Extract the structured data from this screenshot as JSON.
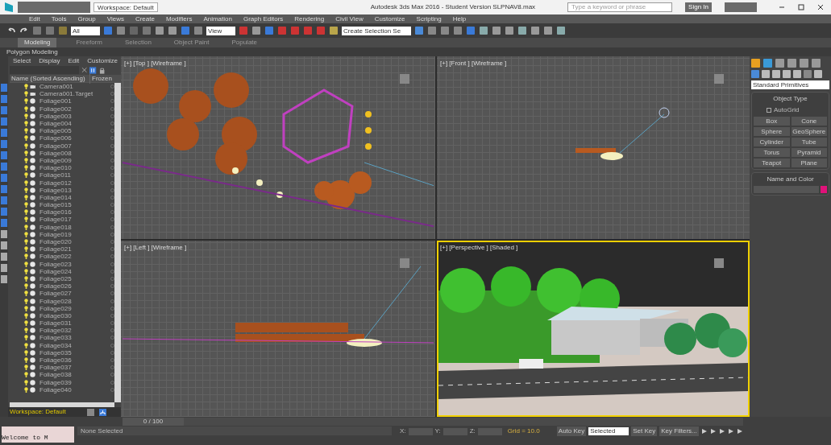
{
  "window": {
    "title": "Autodesk 3ds Max 2016 - Student Version   SLPNAV8.max",
    "workspace": "Workspace: Default",
    "search_placeholder": "Type a keyword or phrase",
    "sign_in": "Sign In"
  },
  "menu": [
    "Edit",
    "Tools",
    "Group",
    "Views",
    "Create",
    "Modifiers",
    "Animation",
    "Graph Editors",
    "Rendering",
    "Civil View",
    "Customize",
    "Scripting",
    "Help"
  ],
  "toolbar": {
    "filter": "All",
    "coord": "View",
    "selection_set": "Create Selection Se"
  },
  "ribbon_tabs": [
    {
      "label": "Modeling",
      "selected": true
    },
    {
      "label": "Freeform",
      "selected": false
    },
    {
      "label": "Selection",
      "selected": false
    },
    {
      "label": "Object Paint",
      "selected": false
    },
    {
      "label": "Populate",
      "selected": false
    }
  ],
  "ribbon_panel": "Polygon Modeling",
  "scene_explorer": {
    "menu": [
      "Select",
      "Display",
      "Edit",
      "Customize"
    ],
    "columns": [
      "Name (Sorted Ascending)",
      "Frozen"
    ],
    "rows": [
      {
        "name": "Camera001",
        "kind": "camera"
      },
      {
        "name": "Camera001.Target",
        "kind": "camera"
      },
      {
        "name": "Foliage001",
        "kind": "foliage"
      },
      {
        "name": "Foliage002",
        "kind": "foliage"
      },
      {
        "name": "Foliage003",
        "kind": "foliage"
      },
      {
        "name": "Foliage004",
        "kind": "foliage"
      },
      {
        "name": "Foliage005",
        "kind": "foliage"
      },
      {
        "name": "Foliage006",
        "kind": "foliage"
      },
      {
        "name": "Foliage007",
        "kind": "foliage"
      },
      {
        "name": "Foliage008",
        "kind": "foliage"
      },
      {
        "name": "Foliage009",
        "kind": "foliage"
      },
      {
        "name": "Foliage010",
        "kind": "foliage"
      },
      {
        "name": "Foliage011",
        "kind": "foliage"
      },
      {
        "name": "Foliage012",
        "kind": "foliage"
      },
      {
        "name": "Foliage013",
        "kind": "foliage"
      },
      {
        "name": "Foliage014",
        "kind": "foliage"
      },
      {
        "name": "Foliage015",
        "kind": "foliage"
      },
      {
        "name": "Foliage016",
        "kind": "foliage"
      },
      {
        "name": "Foliage017",
        "kind": "foliage"
      },
      {
        "name": "Foliage018",
        "kind": "foliage"
      },
      {
        "name": "Foliage019",
        "kind": "foliage"
      },
      {
        "name": "Foliage020",
        "kind": "foliage"
      },
      {
        "name": "Foliage021",
        "kind": "foliage"
      },
      {
        "name": "Foliage022",
        "kind": "foliage"
      },
      {
        "name": "Foliage023",
        "kind": "foliage"
      },
      {
        "name": "Foliage024",
        "kind": "foliage"
      },
      {
        "name": "Foliage025",
        "kind": "foliage"
      },
      {
        "name": "Foliage026",
        "kind": "foliage"
      },
      {
        "name": "Foliage027",
        "kind": "foliage"
      },
      {
        "name": "Foliage028",
        "kind": "foliage"
      },
      {
        "name": "Foliage029",
        "kind": "foliage"
      },
      {
        "name": "Foliage030",
        "kind": "foliage"
      },
      {
        "name": "Foliage031",
        "kind": "foliage"
      },
      {
        "name": "Foliage032",
        "kind": "foliage"
      },
      {
        "name": "Foliage033",
        "kind": "foliage"
      },
      {
        "name": "Foliage034",
        "kind": "foliage"
      },
      {
        "name": "Foliage035",
        "kind": "foliage"
      },
      {
        "name": "Foliage036",
        "kind": "foliage"
      },
      {
        "name": "Foliage037",
        "kind": "foliage"
      },
      {
        "name": "Foliage038",
        "kind": "foliage"
      },
      {
        "name": "Foliage039",
        "kind": "foliage"
      },
      {
        "name": "Foliage040",
        "kind": "foliage"
      }
    ],
    "workspace": "Workspace: Default"
  },
  "viewports": [
    {
      "label": "[+] [Top ] [Wireframe ]",
      "kind": "top",
      "selected": false
    },
    {
      "label": "[+] [Front ] [Wireframe ]",
      "kind": "front",
      "selected": false
    },
    {
      "label": "[+] [Left ] [Wireframe ]",
      "kind": "left",
      "selected": false
    },
    {
      "label": "[+] [Perspective ] [Shaded ]",
      "kind": "perspective",
      "selected": true
    }
  ],
  "command_panel": {
    "category": "Standard Primitives",
    "rollouts": [
      "Object Type",
      "Name and Color"
    ],
    "autogrid": {
      "label": "AutoGrid",
      "checked": false
    },
    "buttons": [
      "Box",
      "Cone",
      "Sphere",
      "GeoSphere",
      "Cylinder",
      "Tube",
      "Torus",
      "Pyramid",
      "Teapot",
      "Plane"
    ]
  },
  "status_bar": {
    "time_slider": {
      "label": "0 / 100",
      "level": 0
    },
    "selection": "None Selected",
    "listener": "Welcome to M",
    "x": "X:",
    "y": "Y:",
    "z": "Z:",
    "grid": "Grid = 10.0",
    "auto_key": "Auto Key",
    "key_mode": "Selected",
    "set_key": "Set Key",
    "key_filters": "Key Filters..."
  }
}
